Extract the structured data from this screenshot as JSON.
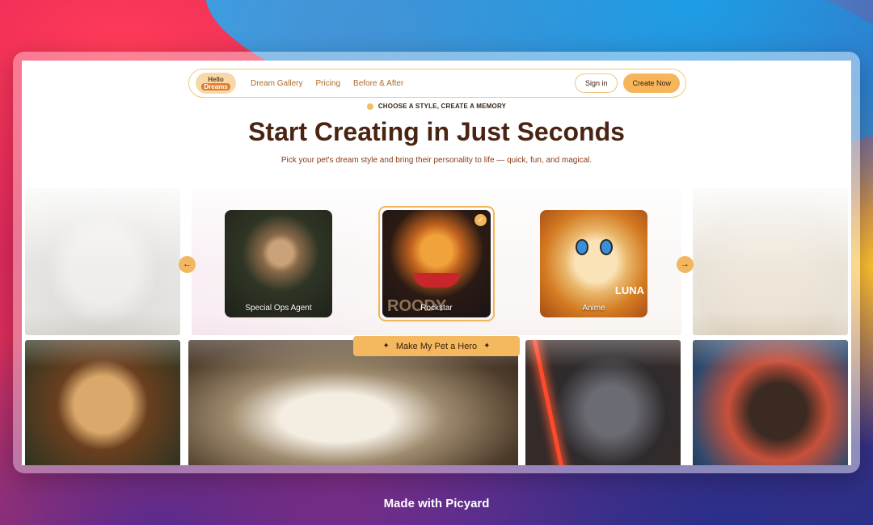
{
  "nav": {
    "logo_line1": "Hello",
    "logo_line2": "Pet",
    "logo_line3": "Dreams",
    "links": [
      "Dream Gallery",
      "Pricing",
      "Before & After"
    ],
    "sign_in": "Sign in",
    "create_now": "Create Now"
  },
  "hero": {
    "eyebrow": "CHOOSE A STYLE, CREATE A MEMORY",
    "title": "Start Creating in Just Seconds",
    "subtitle": "Pick your pet's dream style and bring their personality to life — quick, fun, and magical."
  },
  "styles": [
    {
      "label": "Special Ops Agent",
      "selected": false
    },
    {
      "label": "Rockstar",
      "selected": true,
      "overlay_text": "ROODY"
    },
    {
      "label": "Anime",
      "selected": false,
      "overlay_text": "LUNA"
    }
  ],
  "arrows": {
    "prev_icon": "arrow-left-icon",
    "next_icon": "arrow-right-icon"
  },
  "cta": {
    "label": "Make My Pet a Hero",
    "icon": "sparkle-icon"
  },
  "footer": {
    "made_with": "Made with Picyard"
  },
  "colors": {
    "accent": "#f4b85e",
    "heading": "#4a2412",
    "link": "#b06a2a"
  }
}
